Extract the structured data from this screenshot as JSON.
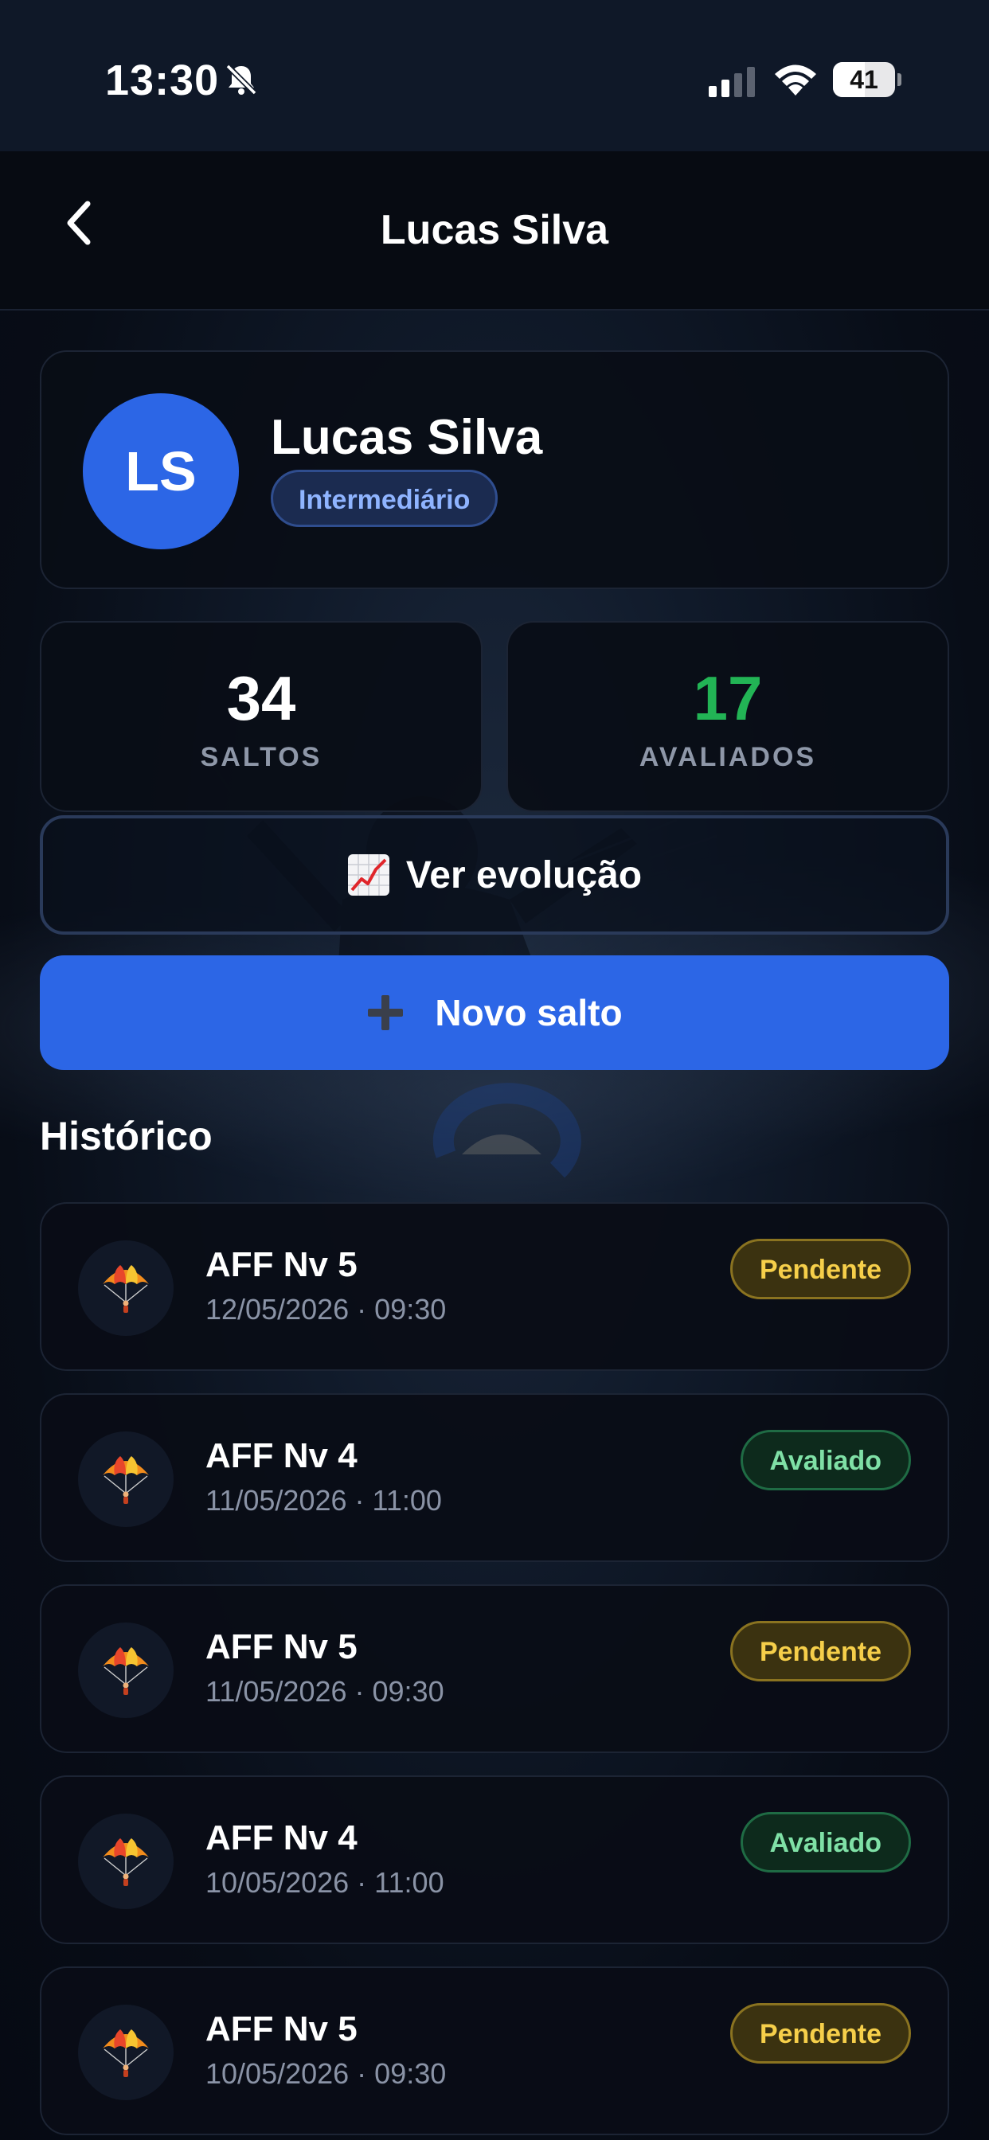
{
  "status_bar": {
    "time": "13:30",
    "battery": "41",
    "icons": [
      "bell-slash-icon",
      "signal-icon",
      "wifi-icon",
      "battery-icon"
    ]
  },
  "header": {
    "title": "Lucas Silva",
    "back_icon": "chevron-left-icon"
  },
  "profile": {
    "initials": "LS",
    "name": "Lucas Silva",
    "level": "Intermediário",
    "avatar_color": "#2c66e6"
  },
  "stats": {
    "saltos": {
      "value": "34",
      "label": "SALTOS",
      "color": "#ffffff"
    },
    "avaliados": {
      "value": "17",
      "label": "AVALIADOS",
      "color": "#22b455"
    }
  },
  "actions": {
    "evolucao_label": "Ver evolução",
    "evolucao_icon": "chart-increasing-icon",
    "novo_salto_label": "Novo salto",
    "novo_salto_icon": "plus-icon",
    "primary_color": "#2c66e6"
  },
  "history": {
    "title": "Histórico",
    "items": [
      {
        "title": "AFF Nv 5",
        "date": "12/05/2026 · 09:30",
        "status": "Pendente",
        "icon": "parachute-icon"
      },
      {
        "title": "AFF Nv 4",
        "date": "11/05/2026 · 11:00",
        "status": "Avaliado",
        "icon": "parachute-icon"
      },
      {
        "title": "AFF Nv 5",
        "date": "11/05/2026 · 09:30",
        "status": "Pendente",
        "icon": "parachute-icon"
      },
      {
        "title": "AFF Nv 4",
        "date": "10/05/2026 · 11:00",
        "status": "Avaliado",
        "icon": "parachute-icon"
      },
      {
        "title": "AFF Nv 5",
        "date": "10/05/2026 · 09:30",
        "status": "Pendente",
        "icon": "parachute-icon"
      }
    ],
    "status_colors": {
      "Pendente": "#f6cf4a",
      "Avaliado": "#7fe0a6"
    }
  }
}
